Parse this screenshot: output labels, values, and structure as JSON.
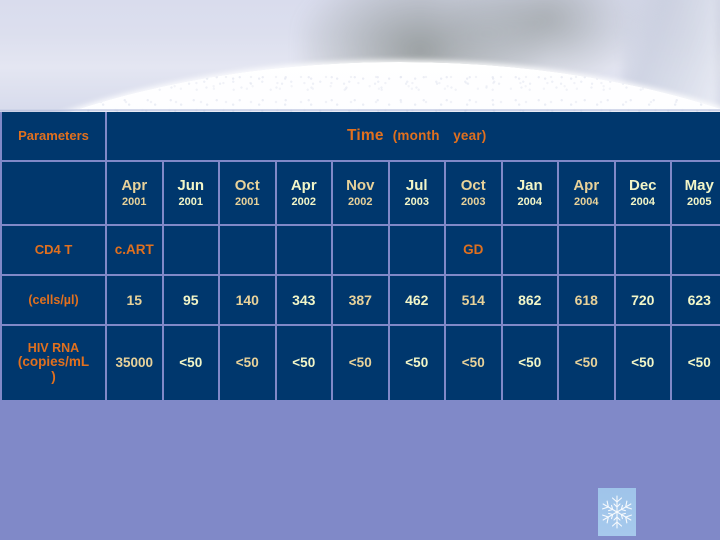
{
  "slide": {
    "background_color": "#8089c8",
    "table_cell_color": "#00376d",
    "accent_label_color": "#e1701e",
    "value_color_a": "#e8d29a",
    "value_color_b": "#f2f6c8"
  },
  "table": {
    "parameters_header": "Parameters",
    "time_header": "Time",
    "time_header_unit_open": "(month",
    "time_header_unit_close": "year)",
    "columns": [
      {
        "month": "Apr",
        "year": "2001",
        "tone": "a"
      },
      {
        "month": "Jun",
        "year": "2001",
        "tone": "b"
      },
      {
        "month": "Oct",
        "year": "2001",
        "tone": "a"
      },
      {
        "month": "Apr",
        "year": "2002",
        "tone": "b"
      },
      {
        "month": "Nov",
        "year": "2002",
        "tone": "a"
      },
      {
        "month": "Jul",
        "year": "2003",
        "tone": "b"
      },
      {
        "month": "Oct",
        "year": "2003",
        "tone": "a"
      },
      {
        "month": "Jan",
        "year": "2004",
        "tone": "b"
      },
      {
        "month": "Apr",
        "year": "2004",
        "tone": "a"
      },
      {
        "month": "Dec",
        "year": "2004",
        "tone": "b"
      },
      {
        "month": "May",
        "year": "2005",
        "tone": "b"
      }
    ],
    "markers": {
      "cart_label": "c.ART",
      "cart_column_index": 0,
      "gd_label": "GD",
      "gd_column_index": 6
    },
    "rows": [
      {
        "name": "cd4-row",
        "label_line1": "CD4 T",
        "label_line2": "(cells/µl)",
        "values": [
          "15",
          "95",
          "140",
          "343",
          "387",
          "462",
          "514",
          "862",
          "618",
          "720",
          "623"
        ],
        "tones": [
          "a",
          "b",
          "a",
          "b",
          "a",
          "b",
          "a",
          "b",
          "a",
          "b",
          "b"
        ]
      },
      {
        "name": "hiv-rna-row",
        "label_line1": "HIV RNA",
        "label_line2": "(copies/mL",
        "label_line3": ")",
        "values": [
          "35000",
          "<50",
          "<50",
          "<50",
          "<50",
          "<50",
          "<50",
          "<50",
          "<50",
          "<50",
          "<50"
        ],
        "tones": [
          "a",
          "b",
          "a",
          "b",
          "a",
          "b",
          "a",
          "b",
          "a",
          "b",
          "b"
        ]
      }
    ]
  },
  "decorations": {
    "snowflake_icon": "snowflake-icon"
  }
}
